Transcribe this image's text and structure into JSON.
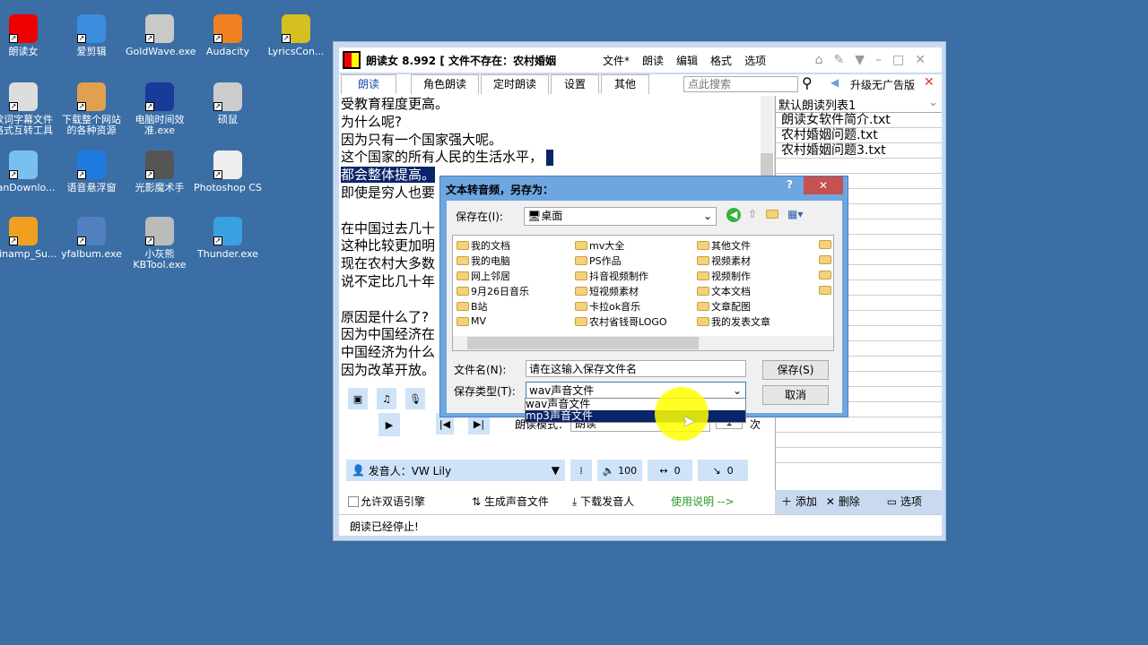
{
  "desktop": {
    "icons": [
      {
        "label": "朗读女",
        "color": "#e00"
      },
      {
        "label": "爱剪辑",
        "color": "#3b8de0"
      },
      {
        "label": "GoldWave.exe",
        "color": "#c9c9c9"
      },
      {
        "label": "Audacity",
        "color": "#f08020"
      },
      {
        "label": "LyricsCon...",
        "color": "#d6c020"
      },
      {
        "label": "歌词字幕文件格式互转工具",
        "color": "#ddd"
      },
      {
        "label": "下载整个网站的各种资源",
        "color": "#e0a050"
      },
      {
        "label": "电脑时间效准.exe",
        "color": "#1a3a9a"
      },
      {
        "label": "硕鼠",
        "color": "#ccc"
      },
      {
        "label": "PanDownlo...",
        "color": "#7ac0ee"
      },
      {
        "label": "语音悬浮窗",
        "color": "#1f7ae0"
      },
      {
        "label": "光影魔术手",
        "color": "#555"
      },
      {
        "label": "Photoshop CS",
        "color": "#eee"
      },
      {
        "label": "Winamp_Su...",
        "color": "#f0a020"
      },
      {
        "label": "yfalbum.exe",
        "color": "#5080c0"
      },
      {
        "label": "小灰熊KBTool.exe",
        "color": "#bbb"
      },
      {
        "label": "Thunder.exe",
        "color": "#3aa0e0"
      }
    ]
  },
  "app": {
    "title": "朗读女 8.992 [ 文件不存在：农村婚姻",
    "menus": [
      "文件*",
      "朗读",
      "编辑",
      "格式",
      "选项"
    ],
    "upgrade": "升级无广告版",
    "tabs": [
      "朗读",
      "角色朗读",
      "定时朗读",
      "设置",
      "其他"
    ],
    "search_placeholder": "点此搜索",
    "editor_lines": [
      "受教育程度更高。",
      "为什么呢?",
      "因为只有一个国家强大呢。",
      "这个国家的所有人民的生活水平，",
      "都会整体提高。",
      "即使是穷人也要",
      "",
      "在中国过去几十",
      "这种比较更加明",
      "现在农村大多数",
      "说不定比几十年",
      "",
      "原因是什么了?",
      "因为中国经济在",
      "中国经济为什么",
      "因为改革开放。"
    ],
    "playlist": {
      "selected": "默认朗读列表1",
      "items": [
        "朗读女软件简介.txt",
        "农村婚姻问题.txt",
        "农村婚姻问题3.txt"
      ]
    },
    "read_mode_label": "朗读模式：",
    "read_mode_value": "朗读",
    "repeat_value": "1",
    "repeat_unit": "次",
    "speaker": "发音人：VW Lily",
    "volume": "100",
    "speed": "0",
    "pitch": "0",
    "bilingual": "允许双语引擎",
    "bilingual_checked": false,
    "generate": "生成声音文件",
    "download_voice": "下载发音人",
    "help": "使用说明 -->",
    "list_add": "添加",
    "list_delete": "删除",
    "list_options": "选项",
    "status": "朗读已经停止!"
  },
  "dialog": {
    "title": "文本转音频，另存为：",
    "save_in_label": "保存在(I):",
    "save_in": "桌面",
    "files": [
      [
        "我的文档",
        "我的电脑",
        "网上邻居",
        "9月26日音乐",
        "B站",
        "MV"
      ],
      [
        "mv大全",
        "PS作品",
        "抖音视频制作",
        "短视频素材",
        "卡拉ok音乐",
        "农村省钱哥LOGO"
      ],
      [
        "其他文件",
        "视频素材",
        "视频制作",
        "文本文档",
        "文章配图",
        "我的发表文章"
      ]
    ],
    "filename_label": "文件名(N):",
    "filename_value": "请在这输入保存文件名",
    "type_label": "保存类型(T):",
    "type_value": "wav声音文件",
    "type_options": [
      "wav声音文件",
      "mp3声音文件"
    ],
    "highlighted_option": "mp3声音文件",
    "save": "保存(S)",
    "cancel": "取消"
  }
}
